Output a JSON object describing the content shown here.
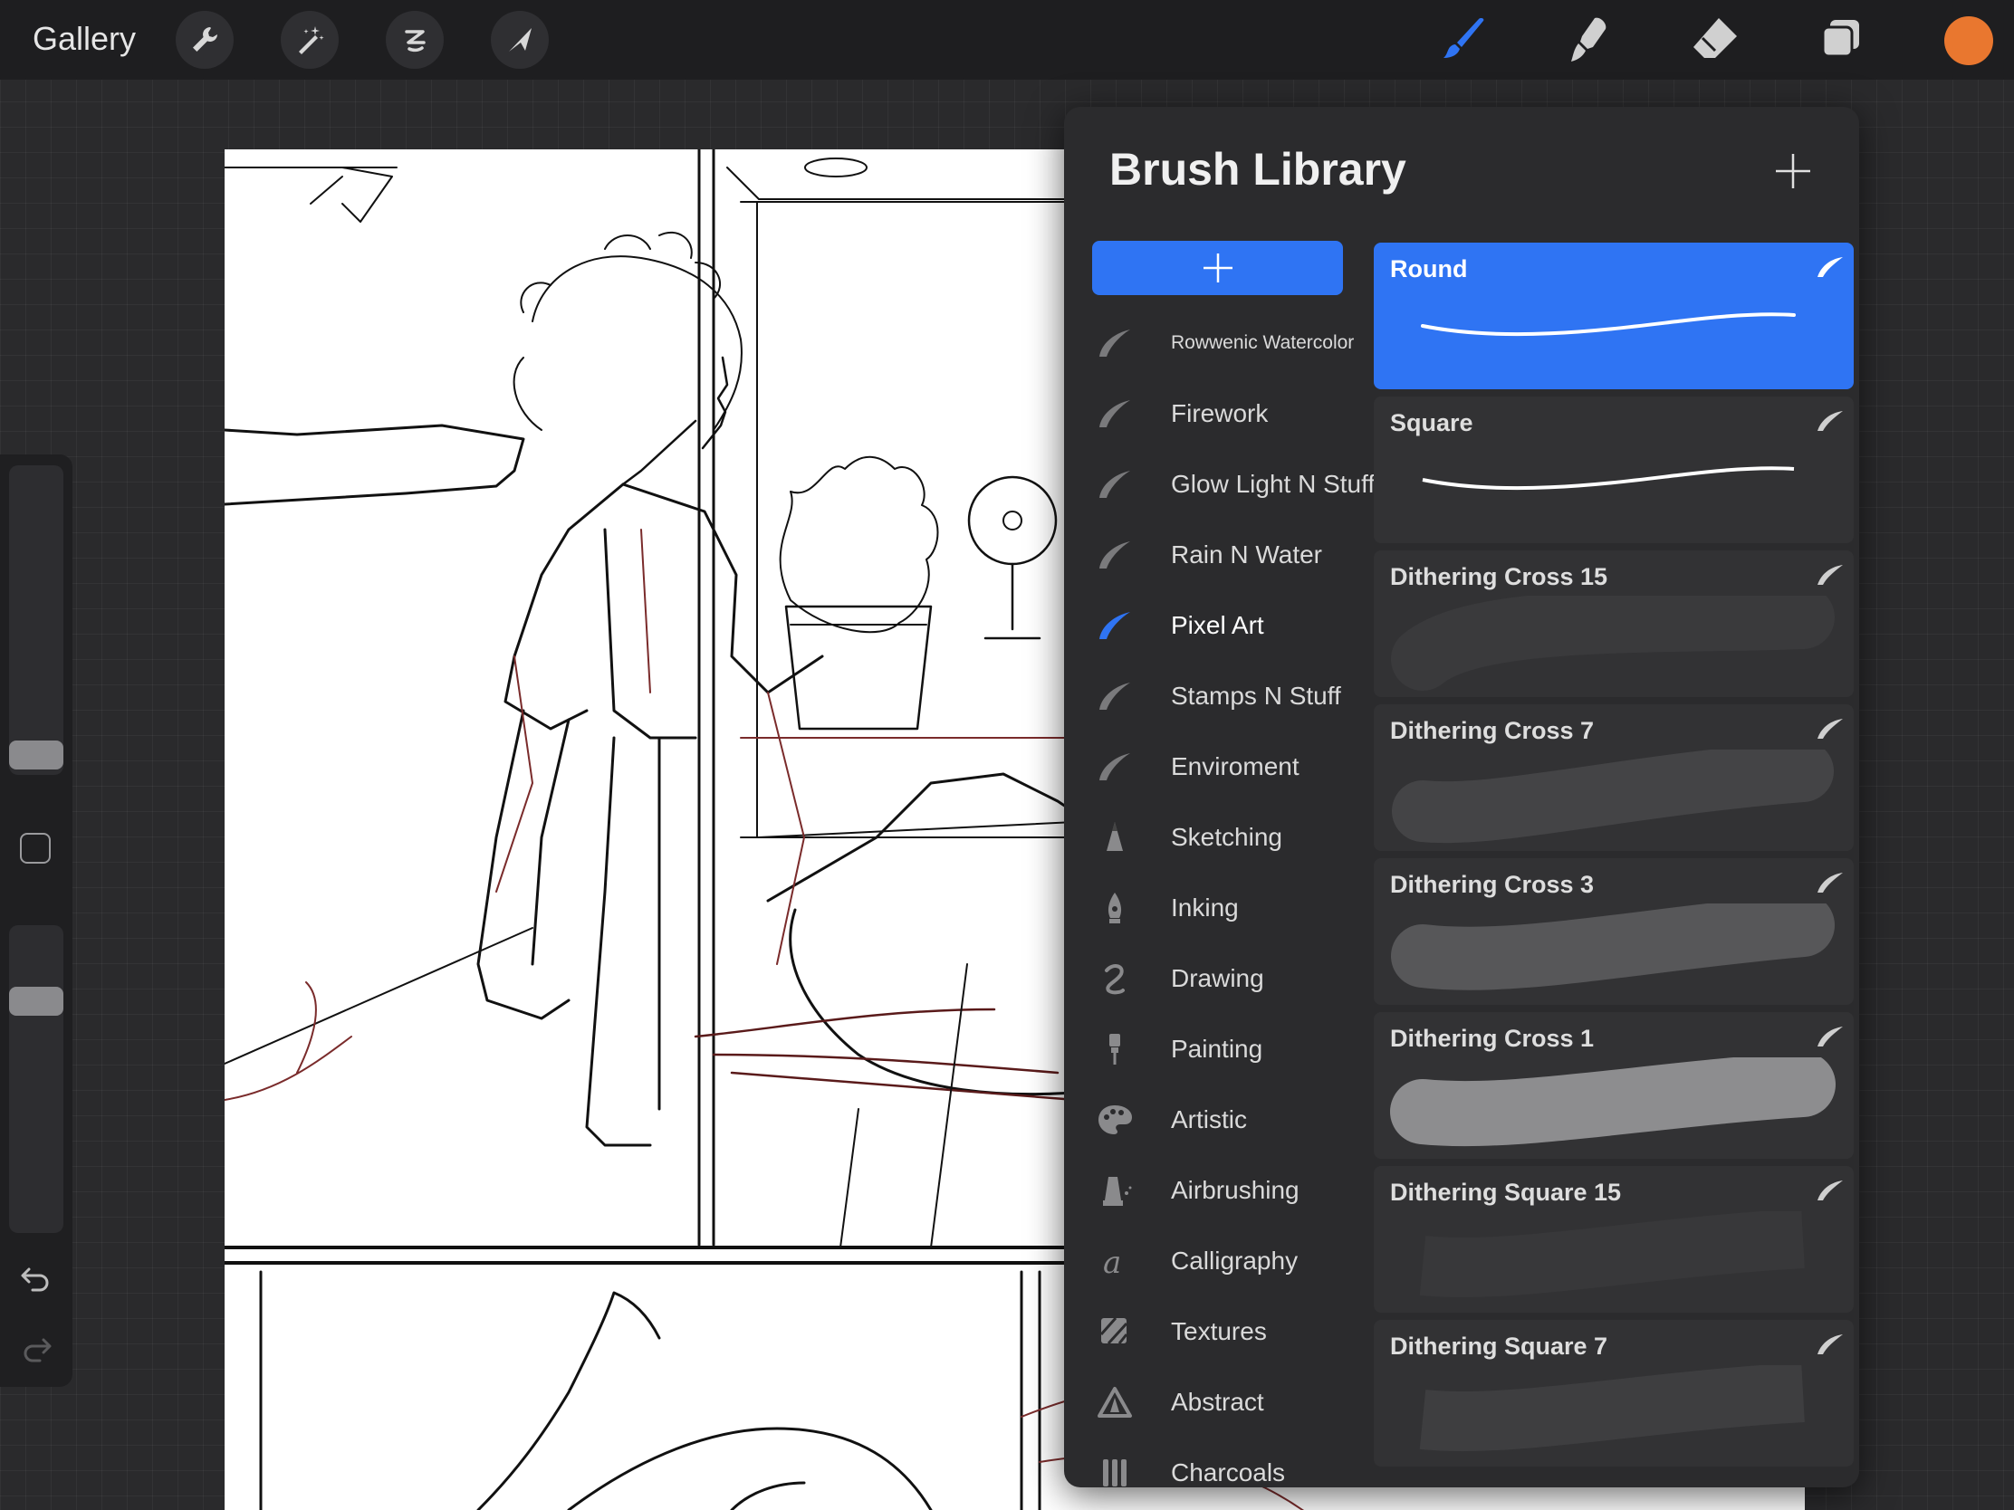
{
  "topbar": {
    "gallery_label": "Gallery",
    "left_tools": [
      {
        "name": "wrench-icon",
        "label": "Actions"
      },
      {
        "name": "magic-wand-icon",
        "label": "Adjustments"
      },
      {
        "name": "selection-icon",
        "label": "Selection"
      },
      {
        "name": "transform-arrow-icon",
        "label": "Transform"
      }
    ],
    "right_tools": [
      {
        "name": "brush-icon",
        "active": true
      },
      {
        "name": "smudge-icon",
        "active": false
      },
      {
        "name": "eraser-icon",
        "active": false
      },
      {
        "name": "layers-icon",
        "active": false
      }
    ],
    "current_color": "#e9772f",
    "active_tool_color": "#2f74f3"
  },
  "sidebar": {
    "size_slider_value": 0.08,
    "opacity_slider_value": 0.95,
    "undo_icon": "undo-icon",
    "redo_icon": "redo-icon"
  },
  "brush_library": {
    "title": "Brush Library",
    "sets": [
      {
        "label": "Rowwenic Watercolor",
        "icon": "brush-stroke-icon",
        "active": false
      },
      {
        "label": "Firework",
        "icon": "brush-stroke-icon",
        "active": false
      },
      {
        "label": "Glow Light N Stuff",
        "icon": "brush-stroke-icon",
        "active": false
      },
      {
        "label": "Rain N Water",
        "icon": "brush-stroke-icon",
        "active": false
      },
      {
        "label": "Pixel Art",
        "icon": "brush-stroke-icon",
        "active": true
      },
      {
        "label": "Stamps N Stuff",
        "icon": "brush-stroke-icon",
        "active": false
      },
      {
        "label": "Enviroment",
        "icon": "brush-stroke-icon",
        "active": false
      },
      {
        "label": "Sketching",
        "icon": "pencil-tip-icon",
        "active": false
      },
      {
        "label": "Inking",
        "icon": "ink-nib-icon",
        "active": false
      },
      {
        "label": "Drawing",
        "icon": "squiggle-icon",
        "active": false
      },
      {
        "label": "Painting",
        "icon": "paint-brush-icon",
        "active": false
      },
      {
        "label": "Artistic",
        "icon": "palette-icon",
        "active": false
      },
      {
        "label": "Airbrushing",
        "icon": "airbrush-icon",
        "active": false
      },
      {
        "label": "Calligraphy",
        "icon": "calligraphy-a-icon",
        "active": false
      },
      {
        "label": "Textures",
        "icon": "texture-icon",
        "active": false
      },
      {
        "label": "Abstract",
        "icon": "triangle-icon",
        "active": false
      },
      {
        "label": "Charcoals",
        "icon": "charcoal-bars-icon",
        "active": false
      }
    ],
    "brushes": [
      {
        "name": "Round",
        "stroke": "line",
        "selected": true
      },
      {
        "name": "Square",
        "stroke": "line",
        "selected": false
      },
      {
        "name": "Dithering Cross 15",
        "stroke": "dither-faint",
        "selected": false
      },
      {
        "name": "Dithering Cross 7",
        "stroke": "dither-dark",
        "selected": false
      },
      {
        "name": "Dithering Cross 3",
        "stroke": "dither-mid",
        "selected": false
      },
      {
        "name": "Dithering Cross 1",
        "stroke": "dither-light",
        "selected": false
      },
      {
        "name": "Dithering Square 15",
        "stroke": "dither-faint",
        "selected": false
      },
      {
        "name": "Dithering Square 7",
        "stroke": "dither-dark",
        "selected": false
      }
    ]
  }
}
